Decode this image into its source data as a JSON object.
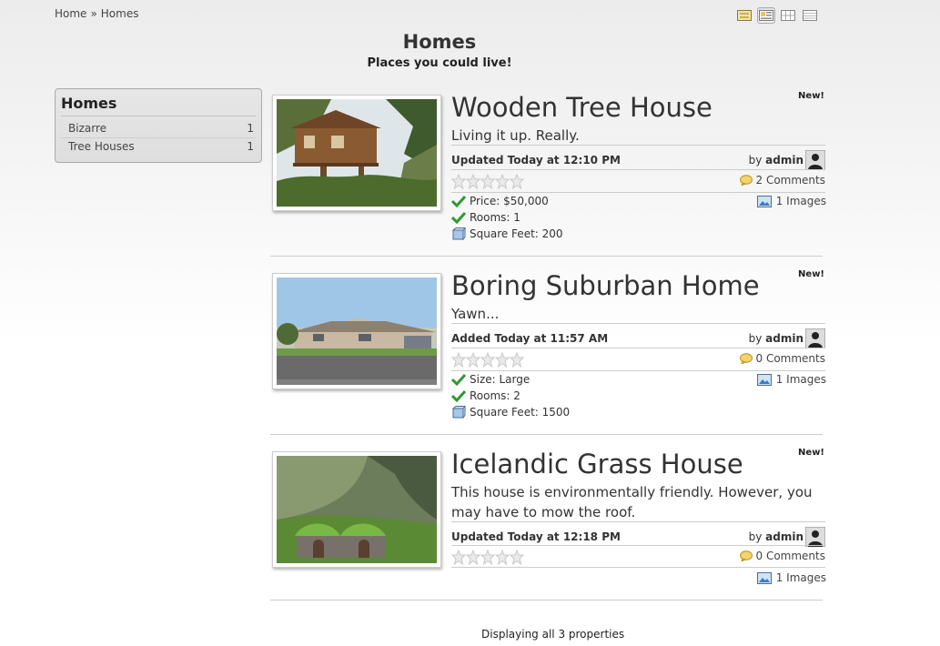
{
  "breadcrumb": {
    "home": "Home",
    "separator": "»",
    "current": "Homes"
  },
  "view_modes": [
    {
      "icon": "list-view-icon",
      "active": false
    },
    {
      "icon": "detail-view-icon",
      "active": true
    },
    {
      "icon": "grid-view-icon",
      "active": false
    },
    {
      "icon": "table-view-icon",
      "active": false
    }
  ],
  "page": {
    "title": "Homes",
    "subtitle": "Places you could live!"
  },
  "sidebar": {
    "title": "Homes",
    "items": [
      {
        "label": "Bizarre",
        "count": "1"
      },
      {
        "label": "Tree Houses",
        "count": "1"
      }
    ]
  },
  "listings": [
    {
      "title": "Wooden Tree House",
      "badge": "New!",
      "tagline": "Living it up. Really.",
      "updated": "Updated Today at 12:10 PM",
      "by": "by",
      "author": "admin",
      "rating": 0,
      "comments": "2 Comments",
      "images": "1 Images",
      "details": [
        {
          "icon": "checkmark-icon",
          "text": "Price: $50,000"
        },
        {
          "icon": "checkmark-icon",
          "text": "Rooms: 1"
        },
        {
          "icon": "cube-icon",
          "text": "Square Feet: 200"
        }
      ]
    },
    {
      "title": "Boring Suburban Home",
      "badge": "New!",
      "tagline": "Yawn...",
      "updated": "Added Today at 11:57 AM",
      "by": "by",
      "author": "admin",
      "rating": 0,
      "comments": "0 Comments",
      "images": "1 Images",
      "details": [
        {
          "icon": "checkmark-icon",
          "text": "Size: Large"
        },
        {
          "icon": "checkmark-icon",
          "text": "Rooms: 2"
        },
        {
          "icon": "cube-icon",
          "text": "Square Feet: 1500"
        }
      ]
    },
    {
      "title": "Icelandic Grass House",
      "badge": "New!",
      "tagline": "This house is environmentally friendly. However, you may have to mow the roof.",
      "updated": "Updated Today at 12:18 PM",
      "by": "by",
      "author": "admin",
      "rating": 0,
      "comments": "0 Comments",
      "images": "1 Images",
      "details": []
    }
  ],
  "footer": {
    "text": "Displaying all 3 properties"
  },
  "colors": {
    "check": "#2e9a2e",
    "title": "#333333",
    "divider": "#cccccc",
    "star": "#d9d9d9"
  }
}
